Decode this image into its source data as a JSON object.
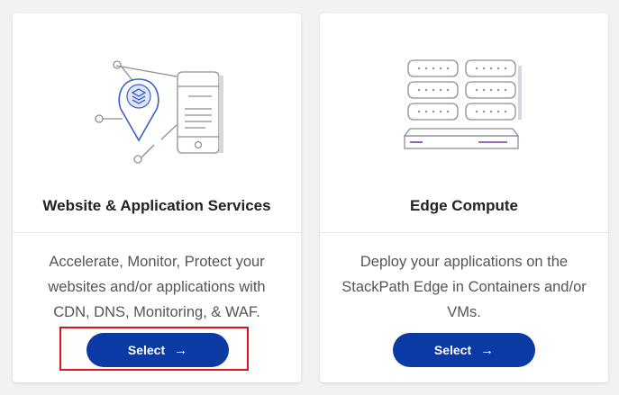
{
  "cards": [
    {
      "title": "Website & Application Services",
      "description": "Accelerate, Monitor, Protect your websites and/or applications with CDN, DNS, Monitoring, & WAF.",
      "button_label": "Select",
      "button_arrow": "→"
    },
    {
      "title": "Edge Compute",
      "description": "Deploy your applications on the StackPath Edge in Containers and/or VMs.",
      "button_label": "Select",
      "button_arrow": "→"
    }
  ],
  "colors": {
    "button": "#0b3aa4",
    "highlight": "#d9141f",
    "icon_accent": "#3b5fc9",
    "server_accent": "#7a3a9e"
  },
  "icons": [
    "website-services-icon",
    "edge-compute-servers-icon",
    "arrow-right-icon"
  ]
}
